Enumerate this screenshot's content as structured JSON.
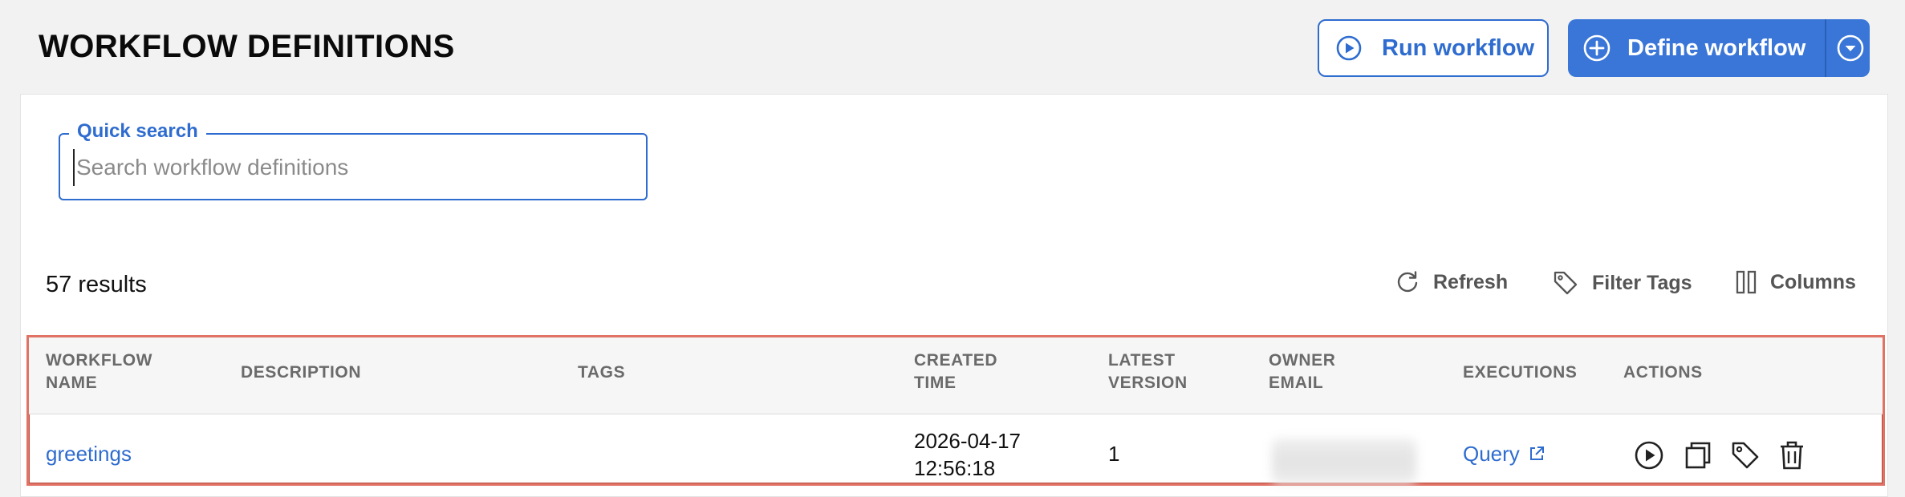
{
  "header": {
    "title": "WORKFLOW DEFINITIONS",
    "run_label": "Run workflow",
    "define_label": "Define workflow"
  },
  "search": {
    "legend": "Quick search",
    "placeholder": "Search workflow definitions",
    "value": ""
  },
  "results": {
    "count_text": "57 results"
  },
  "toolbar": {
    "refresh_label": "Refresh",
    "filter_tags_label": "Filter Tags",
    "columns_label": "Columns"
  },
  "table": {
    "headers": {
      "workflow_name_1": "WORKFLOW",
      "workflow_name_2": "NAME",
      "description": "DESCRIPTION",
      "tags": "TAGS",
      "created_1": "CREATED",
      "created_2": "TIME",
      "version_1": "LATEST",
      "version_2": "VERSION",
      "owner_1": "OWNER",
      "owner_2": "EMAIL",
      "executions": "EXECUTIONS",
      "actions": "ACTIONS"
    },
    "rows": [
      {
        "name": "greetings",
        "description": "",
        "tags": "",
        "created_date": "2026-04-17",
        "created_time": "12:56:18",
        "latest_version": "1",
        "owner_email": "",
        "executions_link": "Query"
      }
    ]
  },
  "icons": {
    "run": "play-circle-icon",
    "define": "plus-circle-icon",
    "define_menu": "chevron-down-circle-icon",
    "refresh": "refresh-icon",
    "filter_tags": "tag-icon",
    "columns": "columns-icon",
    "external": "external-link-icon",
    "action_run": "play-circle-icon",
    "action_copy": "copy-icon",
    "action_tag": "tag-icon",
    "action_delete": "trash-icon"
  },
  "colors": {
    "accent": "#2f6ccf",
    "primary_button": "#3a76d8",
    "highlight_border": "#e07366"
  }
}
